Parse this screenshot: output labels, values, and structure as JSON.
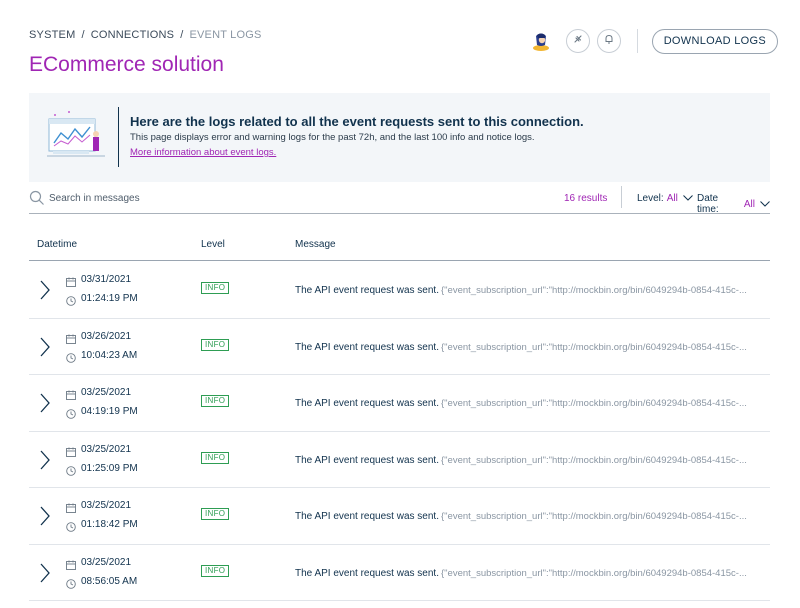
{
  "breadcrumb": [
    "SYSTEM",
    "CONNECTIONS",
    "EVENT LOGS"
  ],
  "breadcrumb_separator": "/",
  "page_title": "ECommerce solution",
  "header": {
    "download_label": "DOWNLOAD LOGS",
    "icons": [
      "avatar",
      "tag-icon",
      "bell-icon"
    ]
  },
  "banner": {
    "title": "Here are the logs related to all the event requests sent to this connection.",
    "text": "This page displays error and warning logs for the past 72h, and the last 100 info and notice logs.",
    "link": "More information about event logs."
  },
  "toolbar": {
    "search_placeholder": "Search in messages",
    "results": "16 results",
    "level_label": "Level:",
    "level_value": "All",
    "datetime_label": "Date time:",
    "datetime_value": "All"
  },
  "table": {
    "columns": [
      "Datetime",
      "Level",
      "Message"
    ],
    "rows": [
      {
        "date": "03/31/2021",
        "time": "01:24:19 PM",
        "level": "INFO",
        "message": "The API event request was sent.",
        "payload": "{\"event_subscription_url\":\"http://mockbin.org/bin/6049294b-0854-415c-..."
      },
      {
        "date": "03/26/2021",
        "time": "10:04:23 AM",
        "level": "INFO",
        "message": "The API event request was sent.",
        "payload": "{\"event_subscription_url\":\"http://mockbin.org/bin/6049294b-0854-415c-..."
      },
      {
        "date": "03/25/2021",
        "time": "04:19:19 PM",
        "level": "INFO",
        "message": "The API event request was sent.",
        "payload": "{\"event_subscription_url\":\"http://mockbin.org/bin/6049294b-0854-415c-..."
      },
      {
        "date": "03/25/2021",
        "time": "01:25:09 PM",
        "level": "INFO",
        "message": "The API event request was sent.",
        "payload": "{\"event_subscription_url\":\"http://mockbin.org/bin/6049294b-0854-415c-..."
      },
      {
        "date": "03/25/2021",
        "time": "01:18:42 PM",
        "level": "INFO",
        "message": "The API event request was sent.",
        "payload": "{\"event_subscription_url\":\"http://mockbin.org/bin/6049294b-0854-415c-..."
      },
      {
        "date": "03/25/2021",
        "time": "08:56:05 AM",
        "level": "INFO",
        "message": "The API event request was sent.",
        "payload": "{\"event_subscription_url\":\"http://mockbin.org/bin/6049294b-0854-415c-..."
      }
    ]
  },
  "colors": {
    "accent": "#a026b4",
    "text": "#11324d",
    "info_badge": "#2e9d53",
    "banner_bg": "#f3f6f9"
  }
}
